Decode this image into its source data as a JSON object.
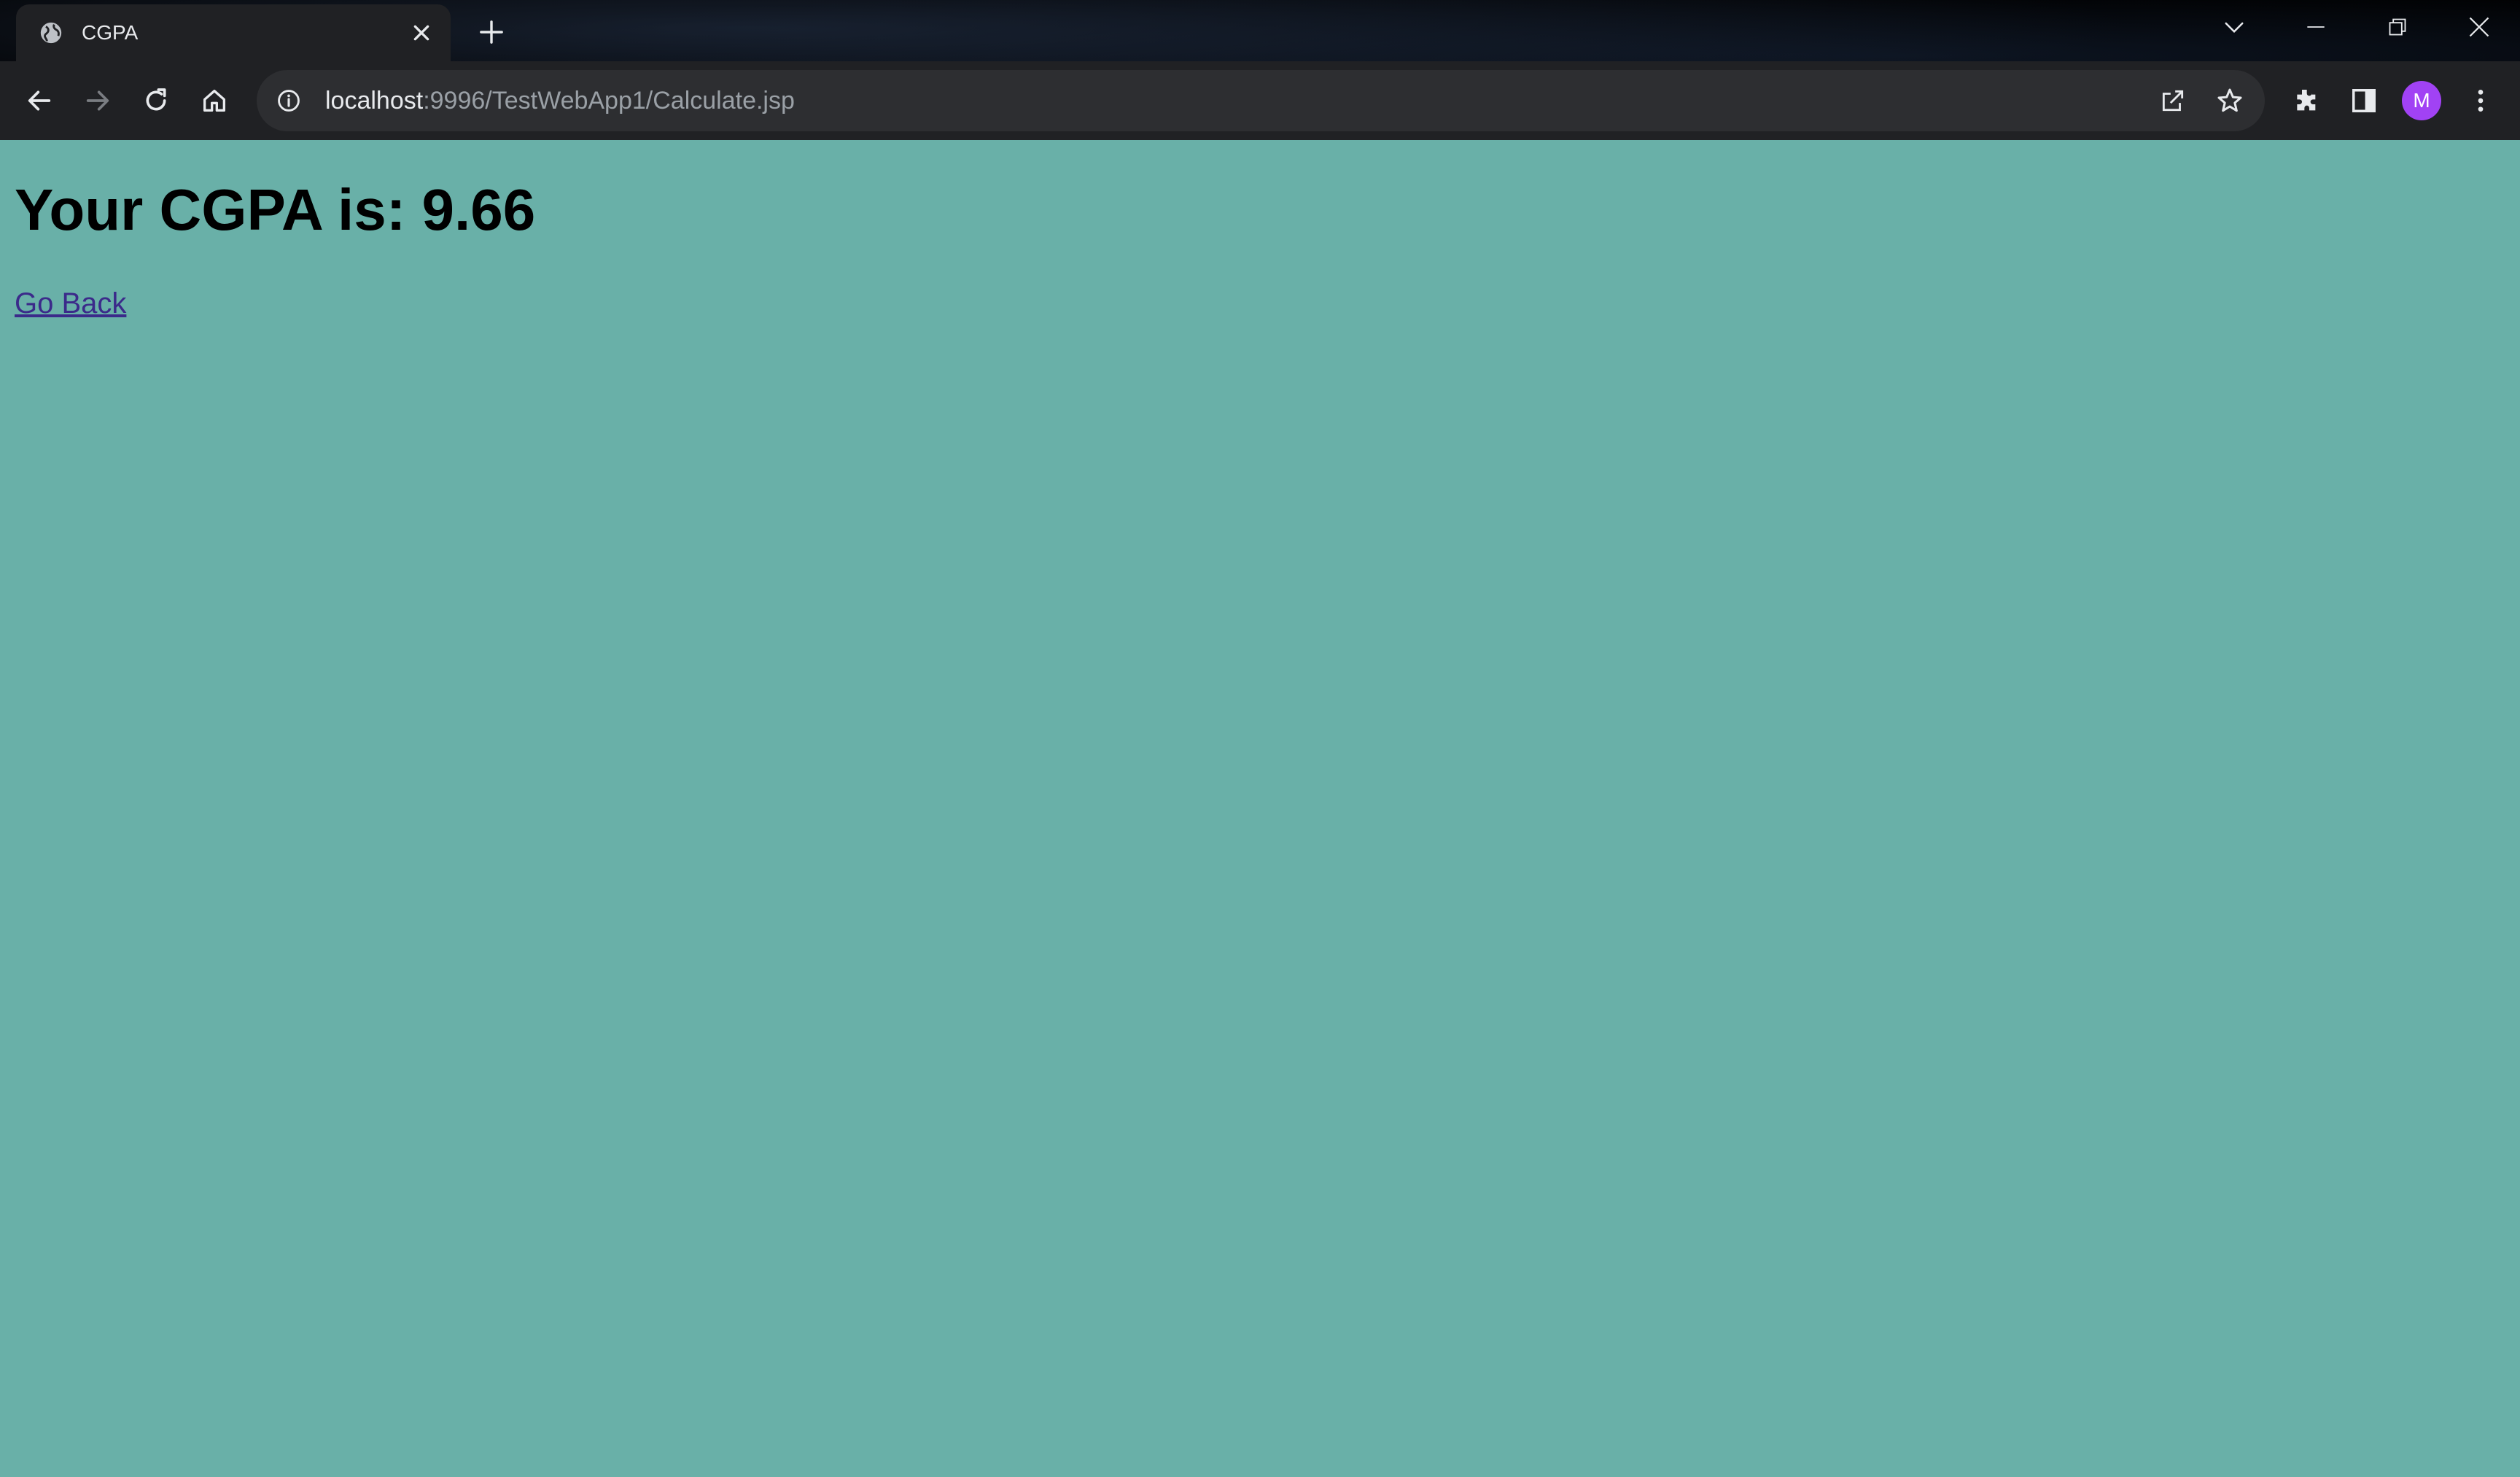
{
  "browser": {
    "tab": {
      "title": "CGPA",
      "favicon": "globe-icon"
    },
    "address_bar": {
      "host": "localhost",
      "path": ":9996/TestWebApp1/Calculate.jsp"
    },
    "profile_initial": "M",
    "colors": {
      "frame": "#000000",
      "toolbar": "#202124",
      "omnibox": "#2d2e31",
      "avatar": "#a142f4"
    }
  },
  "page": {
    "heading": "Your CGPA is: 9.66",
    "back_link": "Go Back",
    "background": "#69b0a8",
    "link_color": "#3b2a8a"
  }
}
